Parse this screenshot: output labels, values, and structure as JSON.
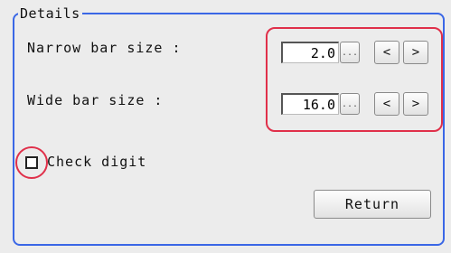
{
  "group": {
    "title": "Details"
  },
  "narrow_bar": {
    "label": "Narrow bar size :",
    "value": "2.0",
    "ellipsis": "...",
    "dec": "<",
    "inc": ">"
  },
  "wide_bar": {
    "label": "Wide bar size :",
    "value": "16.0",
    "ellipsis": "...",
    "dec": "<",
    "inc": ">"
  },
  "check_digit": {
    "label": "Check digit",
    "checked": false
  },
  "return_button": {
    "label": "Return"
  },
  "colors": {
    "groupbox_border": "#3a67e6",
    "highlight": "#e0304a",
    "background": "#ececec"
  }
}
